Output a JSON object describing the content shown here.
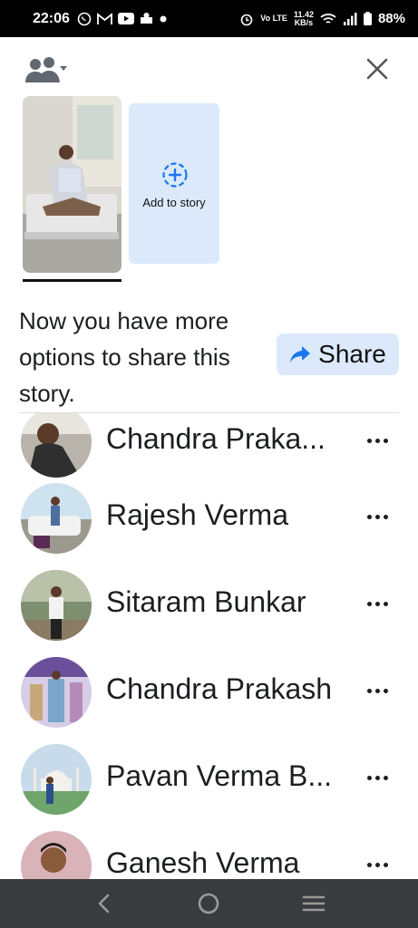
{
  "status_bar": {
    "time": "22:06",
    "network": "Vo LTE",
    "speed_top": "11.42",
    "speed_bottom": "KB/s",
    "battery": "88%",
    "left_icons": [
      "whatsapp-icon",
      "gmail-icon",
      "youtube-icon",
      "app-icon",
      "dot-icon"
    ],
    "right_icons": [
      "alarm-icon",
      "volte-icon",
      "wifi-icon",
      "signal-icon",
      "battery-icon"
    ]
  },
  "header": {
    "audience_icon": "friends-icon",
    "close_icon": "close-icon"
  },
  "story": {
    "add_label": "Add to story"
  },
  "share": {
    "message": "Now you have more options to share this story.",
    "button_label": "Share",
    "accent": "#1877f2"
  },
  "friends": [
    {
      "name": "Chandra Praka..."
    },
    {
      "name": "Rajesh Verma"
    },
    {
      "name": "Sitaram Bunkar"
    },
    {
      "name": "Chandra Prakash"
    },
    {
      "name": "Pavan Verma B..."
    },
    {
      "name": "Ganesh Verma"
    }
  ],
  "navigation": {
    "back": "back-icon",
    "home": "home-icon",
    "recents": "menu-icon"
  }
}
